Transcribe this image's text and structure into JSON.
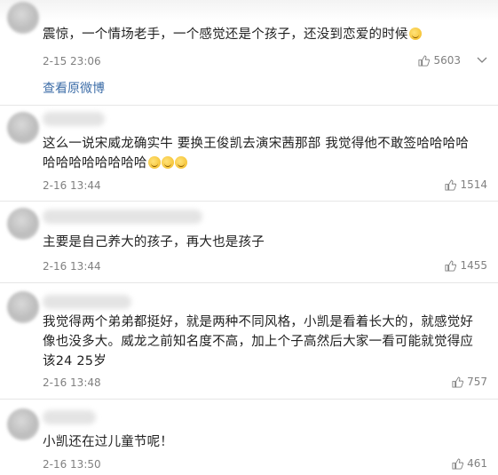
{
  "comments": [
    {
      "text": "震惊，一个情场老手，一个感觉还是个孩子，还没到恋爱的时候",
      "time": "2-15 23:06",
      "likes": "5603"
    },
    {
      "text": "这么一说宋威龙确实牛 要换王俊凯去演宋茜那部 我觉得他不敢签哈哈哈哈哈哈哈哈哈哈哈哈",
      "time": "2-16 13:44",
      "likes": "1514"
    },
    {
      "text": "主要是自己养大的孩子，再大也是孩子",
      "time": "2-16 13:44",
      "likes": "1455"
    },
    {
      "text": "我觉得两个弟弟都挺好，就是两种不同风格，小凯是看着长大的，就感觉好像也没多大。威龙之前知名度不高，加上个子高然后大家一看可能就觉得应该24 25岁",
      "time": "2-16 13:48",
      "likes": "757"
    },
    {
      "text": "小凯还在过儿童节呢！",
      "time": "2-16 13:50",
      "likes": "461"
    }
  ],
  "view_original_label": "查看原微博",
  "comment2_line1": "这么一说宋威龙确实牛 要换王俊凯去演宋茜那部 我觉得他不敢签哈哈哈哈",
  "comment2_line2": "哈哈哈哈哈哈哈哈",
  "comment4_line1": "我觉得两个弟弟都挺好，就是两种不同风格，小凯是看着长大的，就感觉好",
  "comment4_line2": "像也没多大。威龙之前知名度不高，加上个子高然后大家一看可能就觉得应",
  "comment4_line3": "该24 25岁",
  "colors": {
    "link": "#3e6ea8",
    "meta": "#808080",
    "text": "#222222"
  },
  "icons": {
    "like": "thumbs-up-icon",
    "more": "chevron-down-icon",
    "emoji": "laughing-emoji-icon"
  }
}
